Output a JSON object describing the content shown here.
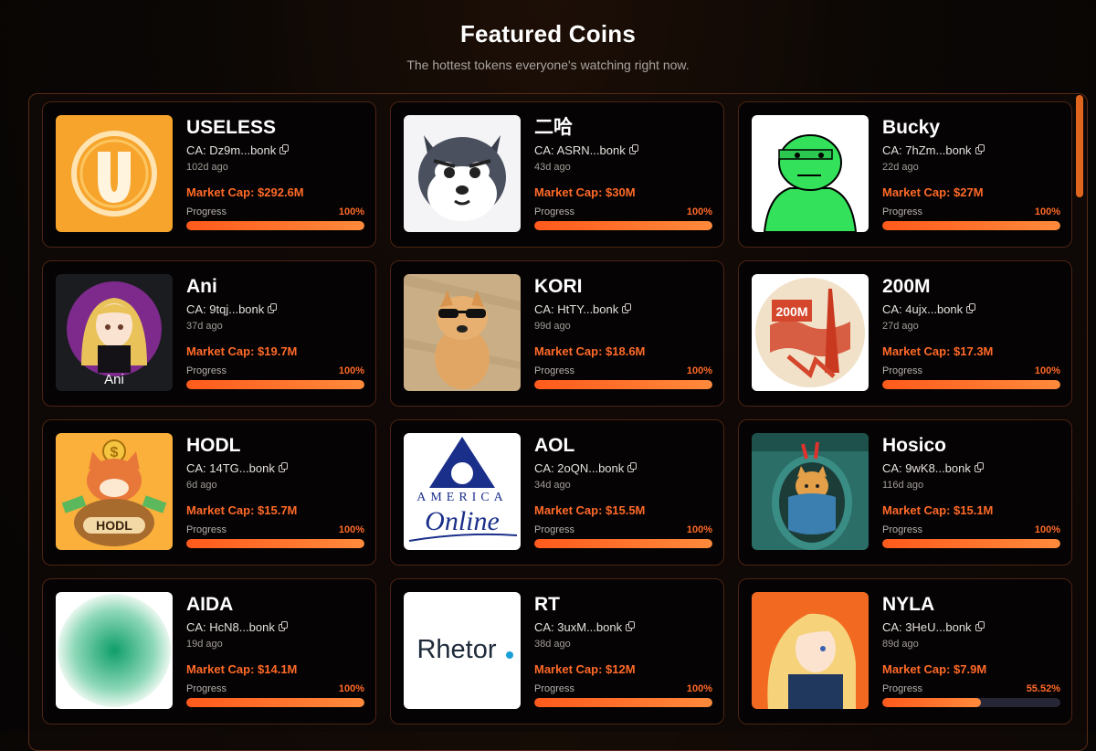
{
  "header": {
    "title": "Featured Coins",
    "subtitle": "The hottest tokens everyone's watching right now."
  },
  "labels": {
    "progress": "Progress"
  },
  "colors": {
    "accent": "#ff6a28",
    "progress_track": "#262636",
    "card_border": "#4d2414"
  },
  "coins": [
    {
      "name": "USELESS",
      "ca": "CA: Dz9m...bonk",
      "age": "102d ago",
      "market_cap": "Market Cap: $292.6M",
      "progress_pct": "100%",
      "progress": 100,
      "image": "useless-logo"
    },
    {
      "name": "二哈",
      "ca": "CA: ASRN...bonk",
      "age": "43d ago",
      "market_cap": "Market Cap: $30M",
      "progress_pct": "100%",
      "progress": 100,
      "image": "husky-face"
    },
    {
      "name": "Bucky",
      "ca": "CA: 7hZm...bonk",
      "age": "22d ago",
      "market_cap": "Market Cap: $27M",
      "progress_pct": "100%",
      "progress": 100,
      "image": "green-frog-figure"
    },
    {
      "name": "Ani",
      "ca": "CA: 9tqj...bonk",
      "age": "37d ago",
      "market_cap": "Market Cap: $19.7M",
      "progress_pct": "100%",
      "progress": 100,
      "image": "anime-girl-avatar",
      "image_caption": "Ani"
    },
    {
      "name": "KORI",
      "ca": "CA: HtTY...bonk",
      "age": "99d ago",
      "market_cap": "Market Cap: $18.6M",
      "progress_pct": "100%",
      "progress": 100,
      "image": "dog-with-sunglasses"
    },
    {
      "name": "200M",
      "ca": "CA: 4ujx...bonk",
      "age": "27d ago",
      "market_cap": "Market Cap: $17.3M",
      "progress_pct": "100%",
      "progress": 100,
      "image": "200m-poster",
      "image_text": "200M"
    },
    {
      "name": "HODL",
      "ca": "CA: 14TG...bonk",
      "age": "6d ago",
      "market_cap": "Market Cap: $15.7M",
      "progress_pct": "100%",
      "progress": 100,
      "image": "shiba-money-bag",
      "image_text": "HODL"
    },
    {
      "name": "AOL",
      "ca": "CA: 2oQN...bonk",
      "age": "34d ago",
      "market_cap": "Market Cap: $15.5M",
      "progress_pct": "100%",
      "progress": 100,
      "image": "america-online-logo",
      "image_text_top": "AMERICA",
      "image_text_bottom": "Online"
    },
    {
      "name": "Hosico",
      "ca": "CA: 9wK8...bonk",
      "age": "116d ago",
      "market_cap": "Market Cap: $15.1M",
      "progress_pct": "100%",
      "progress": 100,
      "image": "cat-in-blanket"
    },
    {
      "name": "AIDA",
      "ca": "CA: HcN8...bonk",
      "age": "19d ago",
      "market_cap": "Market Cap: $14.1M",
      "progress_pct": "100%",
      "progress": 100,
      "image": "green-gradient-orb"
    },
    {
      "name": "RT",
      "ca": "CA: 3uxM...bonk",
      "age": "38d ago",
      "market_cap": "Market Cap: $12M",
      "progress_pct": "100%",
      "progress": 100,
      "image": "rhetor-logo",
      "image_text": "Rhetor"
    },
    {
      "name": "NYLA",
      "ca": "CA: 3HeU...bonk",
      "age": "89d ago",
      "market_cap": "Market Cap: $7.9M",
      "progress_pct": "55.52%",
      "progress": 55.52,
      "image": "anime-blonde-girl"
    }
  ]
}
